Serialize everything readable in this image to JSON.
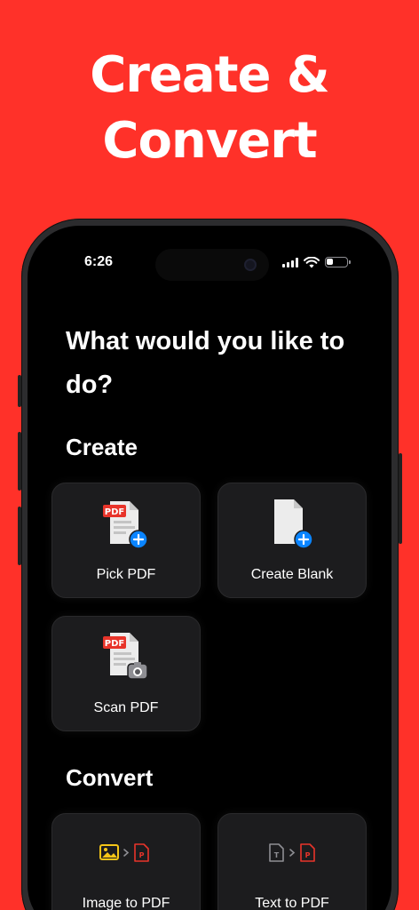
{
  "headline": {
    "line1": "Create &",
    "line2": "Convert"
  },
  "status_bar": {
    "time": "6:26",
    "battery_level": 0.35
  },
  "screen": {
    "question": "What would you like to do?",
    "create_section": {
      "title": "Create",
      "cards": [
        {
          "label": "Pick PDF",
          "icon": "pdf-file-add-icon"
        },
        {
          "label": "Create Blank",
          "icon": "blank-file-add-icon"
        },
        {
          "label": "Scan PDF",
          "icon": "pdf-scan-camera-icon"
        }
      ]
    },
    "convert_section": {
      "title": "Convert",
      "cards": [
        {
          "label": "Image to PDF",
          "icon": "image-to-pdf-icon"
        },
        {
          "label": "Text to PDF",
          "icon": "text-to-pdf-icon"
        }
      ]
    },
    "pdf_badge_text": "PDF"
  },
  "colors": {
    "background": "#ff3129",
    "card": "#1c1c1e",
    "accent_blue": "#0a84ff",
    "pdf_red": "#e8342a",
    "image_yellow": "#f5c518"
  }
}
